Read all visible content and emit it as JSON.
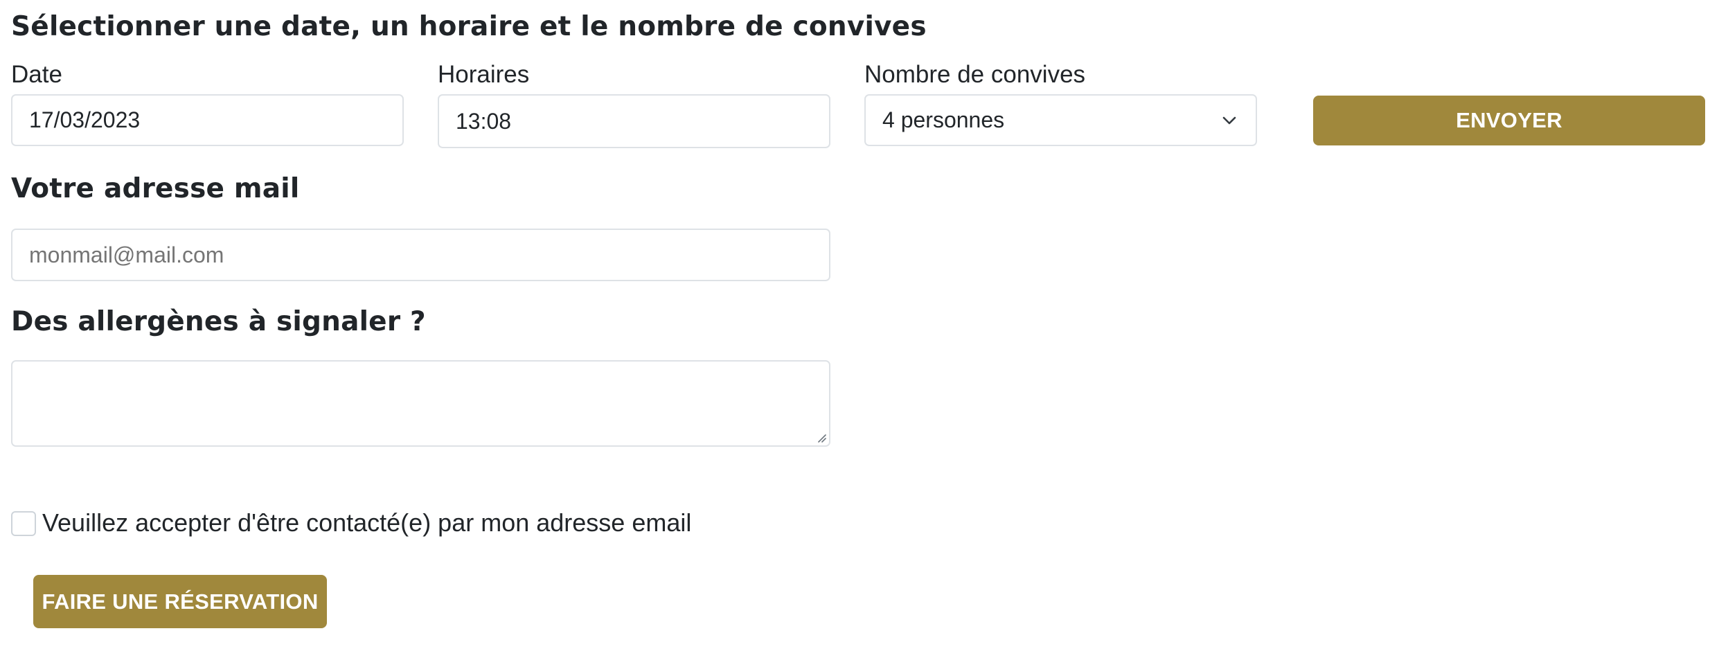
{
  "section_titles": {
    "date_time_guests": "Sélectionner une date, un horaire et le nombre de convives",
    "email": "Votre adresse mail",
    "allergens": "Des allergènes à signaler ?"
  },
  "date_field": {
    "label": "Date",
    "value": "17/03/2023"
  },
  "time_field": {
    "label": "Horaires",
    "value": "13:08"
  },
  "guests_select": {
    "label": "Nombre de convives",
    "selected": "4 personnes",
    "icon": "chevron-down-icon"
  },
  "send_button": {
    "label": "ENVOYER"
  },
  "email_field": {
    "placeholder": "monmail@mail.com",
    "value": ""
  },
  "allergens_field": {
    "value": ""
  },
  "consent": {
    "checked": false,
    "label": "Veuillez accepter d'être contacté(e) par mon adresse email"
  },
  "reserve_button": {
    "label": "FAIRE UNE RÉSERVATION"
  },
  "colors": {
    "accent": "#a0883c",
    "text": "#212529",
    "border": "#dee2e6",
    "background": "#ffffff"
  }
}
